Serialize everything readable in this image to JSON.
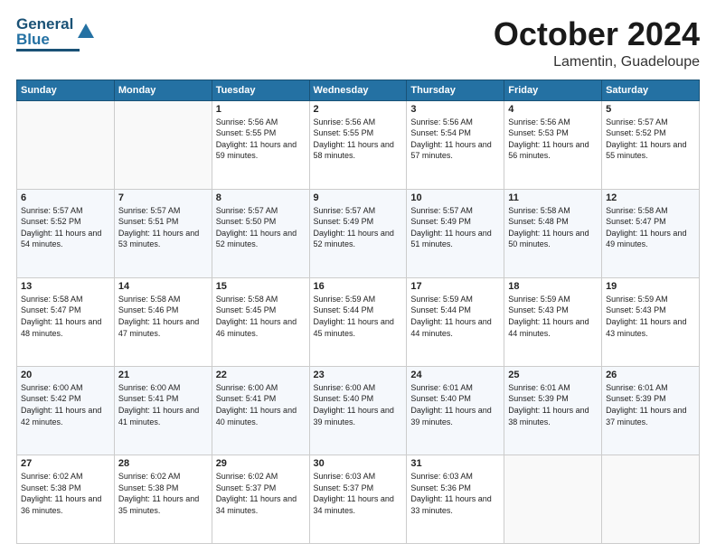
{
  "header": {
    "logo": {
      "line1": "General",
      "line2": "Blue"
    },
    "title": "October 2024",
    "location": "Lamentin, Guadeloupe"
  },
  "days_of_week": [
    "Sunday",
    "Monday",
    "Tuesday",
    "Wednesday",
    "Thursday",
    "Friday",
    "Saturday"
  ],
  "weeks": [
    [
      {
        "day": "",
        "info": ""
      },
      {
        "day": "",
        "info": ""
      },
      {
        "day": "1",
        "info": "Sunrise: 5:56 AM\nSunset: 5:55 PM\nDaylight: 11 hours and 59 minutes."
      },
      {
        "day": "2",
        "info": "Sunrise: 5:56 AM\nSunset: 5:55 PM\nDaylight: 11 hours and 58 minutes."
      },
      {
        "day": "3",
        "info": "Sunrise: 5:56 AM\nSunset: 5:54 PM\nDaylight: 11 hours and 57 minutes."
      },
      {
        "day": "4",
        "info": "Sunrise: 5:56 AM\nSunset: 5:53 PM\nDaylight: 11 hours and 56 minutes."
      },
      {
        "day": "5",
        "info": "Sunrise: 5:57 AM\nSunset: 5:52 PM\nDaylight: 11 hours and 55 minutes."
      }
    ],
    [
      {
        "day": "6",
        "info": "Sunrise: 5:57 AM\nSunset: 5:52 PM\nDaylight: 11 hours and 54 minutes."
      },
      {
        "day": "7",
        "info": "Sunrise: 5:57 AM\nSunset: 5:51 PM\nDaylight: 11 hours and 53 minutes."
      },
      {
        "day": "8",
        "info": "Sunrise: 5:57 AM\nSunset: 5:50 PM\nDaylight: 11 hours and 52 minutes."
      },
      {
        "day": "9",
        "info": "Sunrise: 5:57 AM\nSunset: 5:49 PM\nDaylight: 11 hours and 52 minutes."
      },
      {
        "day": "10",
        "info": "Sunrise: 5:57 AM\nSunset: 5:49 PM\nDaylight: 11 hours and 51 minutes."
      },
      {
        "day": "11",
        "info": "Sunrise: 5:58 AM\nSunset: 5:48 PM\nDaylight: 11 hours and 50 minutes."
      },
      {
        "day": "12",
        "info": "Sunrise: 5:58 AM\nSunset: 5:47 PM\nDaylight: 11 hours and 49 minutes."
      }
    ],
    [
      {
        "day": "13",
        "info": "Sunrise: 5:58 AM\nSunset: 5:47 PM\nDaylight: 11 hours and 48 minutes."
      },
      {
        "day": "14",
        "info": "Sunrise: 5:58 AM\nSunset: 5:46 PM\nDaylight: 11 hours and 47 minutes."
      },
      {
        "day": "15",
        "info": "Sunrise: 5:58 AM\nSunset: 5:45 PM\nDaylight: 11 hours and 46 minutes."
      },
      {
        "day": "16",
        "info": "Sunrise: 5:59 AM\nSunset: 5:44 PM\nDaylight: 11 hours and 45 minutes."
      },
      {
        "day": "17",
        "info": "Sunrise: 5:59 AM\nSunset: 5:44 PM\nDaylight: 11 hours and 44 minutes."
      },
      {
        "day": "18",
        "info": "Sunrise: 5:59 AM\nSunset: 5:43 PM\nDaylight: 11 hours and 44 minutes."
      },
      {
        "day": "19",
        "info": "Sunrise: 5:59 AM\nSunset: 5:43 PM\nDaylight: 11 hours and 43 minutes."
      }
    ],
    [
      {
        "day": "20",
        "info": "Sunrise: 6:00 AM\nSunset: 5:42 PM\nDaylight: 11 hours and 42 minutes."
      },
      {
        "day": "21",
        "info": "Sunrise: 6:00 AM\nSunset: 5:41 PM\nDaylight: 11 hours and 41 minutes."
      },
      {
        "day": "22",
        "info": "Sunrise: 6:00 AM\nSunset: 5:41 PM\nDaylight: 11 hours and 40 minutes."
      },
      {
        "day": "23",
        "info": "Sunrise: 6:00 AM\nSunset: 5:40 PM\nDaylight: 11 hours and 39 minutes."
      },
      {
        "day": "24",
        "info": "Sunrise: 6:01 AM\nSunset: 5:40 PM\nDaylight: 11 hours and 39 minutes."
      },
      {
        "day": "25",
        "info": "Sunrise: 6:01 AM\nSunset: 5:39 PM\nDaylight: 11 hours and 38 minutes."
      },
      {
        "day": "26",
        "info": "Sunrise: 6:01 AM\nSunset: 5:39 PM\nDaylight: 11 hours and 37 minutes."
      }
    ],
    [
      {
        "day": "27",
        "info": "Sunrise: 6:02 AM\nSunset: 5:38 PM\nDaylight: 11 hours and 36 minutes."
      },
      {
        "day": "28",
        "info": "Sunrise: 6:02 AM\nSunset: 5:38 PM\nDaylight: 11 hours and 35 minutes."
      },
      {
        "day": "29",
        "info": "Sunrise: 6:02 AM\nSunset: 5:37 PM\nDaylight: 11 hours and 34 minutes."
      },
      {
        "day": "30",
        "info": "Sunrise: 6:03 AM\nSunset: 5:37 PM\nDaylight: 11 hours and 34 minutes."
      },
      {
        "day": "31",
        "info": "Sunrise: 6:03 AM\nSunset: 5:36 PM\nDaylight: 11 hours and 33 minutes."
      },
      {
        "day": "",
        "info": ""
      },
      {
        "day": "",
        "info": ""
      }
    ]
  ]
}
